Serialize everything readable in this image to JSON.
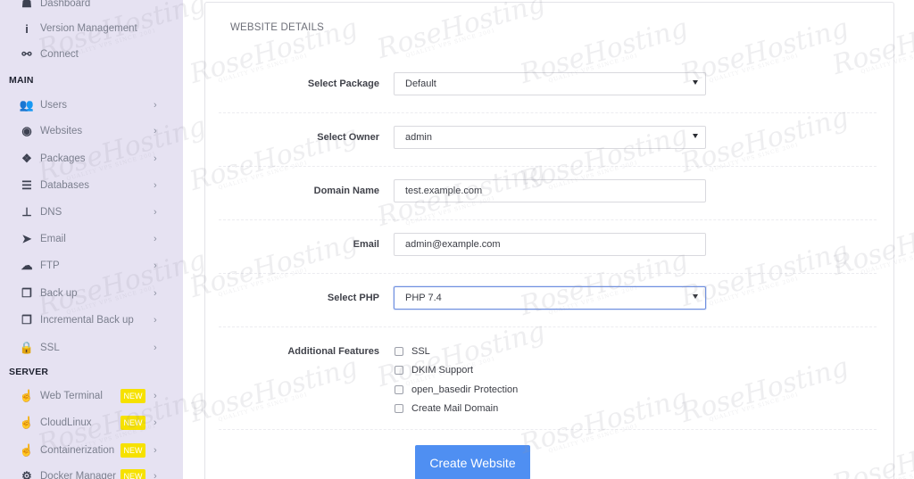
{
  "sidebar": {
    "items": [
      {
        "label": "Dashboard",
        "icon": "dashboard-icon",
        "glyph": "☗"
      },
      {
        "label": "Version Management",
        "icon": "info-icon",
        "glyph": "i"
      },
      {
        "label": "Connect",
        "icon": "link-icon",
        "glyph": "⚯"
      }
    ],
    "section_main": "MAIN",
    "main_items": [
      {
        "label": "Users",
        "icon": "users-icon",
        "glyph": "👥"
      },
      {
        "label": "Websites",
        "icon": "globe-icon",
        "glyph": "◉"
      },
      {
        "label": "Packages",
        "icon": "packages-icon",
        "glyph": "❖"
      },
      {
        "label": "Databases",
        "icon": "database-icon",
        "glyph": "☰"
      },
      {
        "label": "DNS",
        "icon": "sitemap-icon",
        "glyph": "⊥"
      },
      {
        "label": "Email",
        "icon": "paper-plane-icon",
        "glyph": "➤"
      },
      {
        "label": "FTP",
        "icon": "cloud-upload-icon",
        "glyph": "☁"
      },
      {
        "label": "Back up",
        "icon": "copy-icon",
        "glyph": "❐"
      },
      {
        "label": "Incremental Back up",
        "icon": "copy-icon",
        "glyph": "❐"
      },
      {
        "label": "SSL",
        "icon": "lock-icon",
        "glyph": "🔒"
      }
    ],
    "section_server": "SERVER",
    "server_items": [
      {
        "label": "Web Terminal",
        "icon": "hand-pointer-icon",
        "glyph": "☝",
        "badge": "NEW"
      },
      {
        "label": "CloudLinux",
        "icon": "hand-pointer-icon",
        "glyph": "☝",
        "badge": "NEW"
      },
      {
        "label": "Containerization",
        "icon": "hand-pointer-icon",
        "glyph": "☝",
        "badge": "NEW"
      },
      {
        "label": "Docker Manager",
        "icon": "cogs-icon",
        "glyph": "⚙",
        "badge": "NEW"
      }
    ],
    "chevron": "›"
  },
  "card": {
    "title": "WEBSITE DETAILS"
  },
  "form": {
    "package_label": "Select Package",
    "package_value": "Default",
    "owner_label": "Select Owner",
    "owner_value": "admin",
    "domain_label": "Domain Name",
    "domain_value": "test.example.com",
    "email_label": "Email",
    "email_value": "admin@example.com",
    "php_label": "Select PHP",
    "php_value": "PHP 7.4",
    "features_label": "Additional Features",
    "features": [
      "SSL",
      "DKIM Support",
      "open_basedir Protection",
      "Create Mail Domain"
    ],
    "submit_label": "Create Website"
  },
  "watermark": {
    "text": "RoseHosting",
    "subtext": "QUALITY VPS SINCE 2001"
  },
  "colors": {
    "sidebar_bg": "#e6e2f2",
    "accent": "#4f8ff2",
    "badge": "#f6e100"
  }
}
